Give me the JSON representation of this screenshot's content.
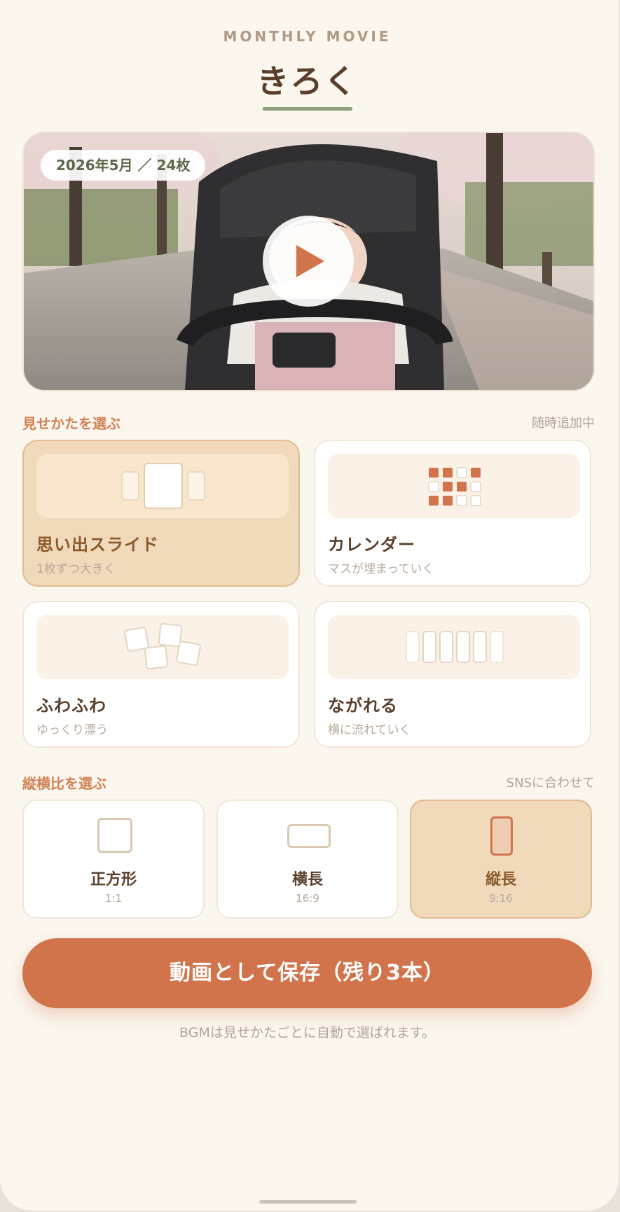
{
  "header": {
    "eyebrow": "MONTHLY MOVIE",
    "title": "きろく"
  },
  "hero": {
    "badge": "2026年5月 ／ 24枚",
    "play_icon": "play-icon"
  },
  "styles": {
    "label": "見せかたを選ぶ",
    "note": "随時追加中",
    "items": [
      {
        "title": "思い出スライド",
        "subtitle": "1枚ずつ大きく",
        "selected": true
      },
      {
        "title": "カレンダー",
        "subtitle": "マスが埋まっていく",
        "selected": false
      },
      {
        "title": "ふわふわ",
        "subtitle": "ゆっくり漂う",
        "selected": false
      },
      {
        "title": "ながれる",
        "subtitle": "横に流れていく",
        "selected": false
      }
    ]
  },
  "ratios": {
    "label": "縦横比を選ぶ",
    "note": "SNSに合わせて",
    "items": [
      {
        "label": "正方形",
        "value": "1:1",
        "selected": false
      },
      {
        "label": "横長",
        "value": "16:9",
        "selected": false
      },
      {
        "label": "縦長",
        "value": "9:16",
        "selected": true
      }
    ]
  },
  "save_button": "動画として保存（残り3本）",
  "footnote": "BGMは見せかたごとに自動で選ばれます。",
  "colors": {
    "accent": "#d2744b",
    "selected_bg": "#f1d9bc",
    "section_label": "#d08356",
    "underline": "#8fa07e",
    "background": "#fbf6ee"
  }
}
